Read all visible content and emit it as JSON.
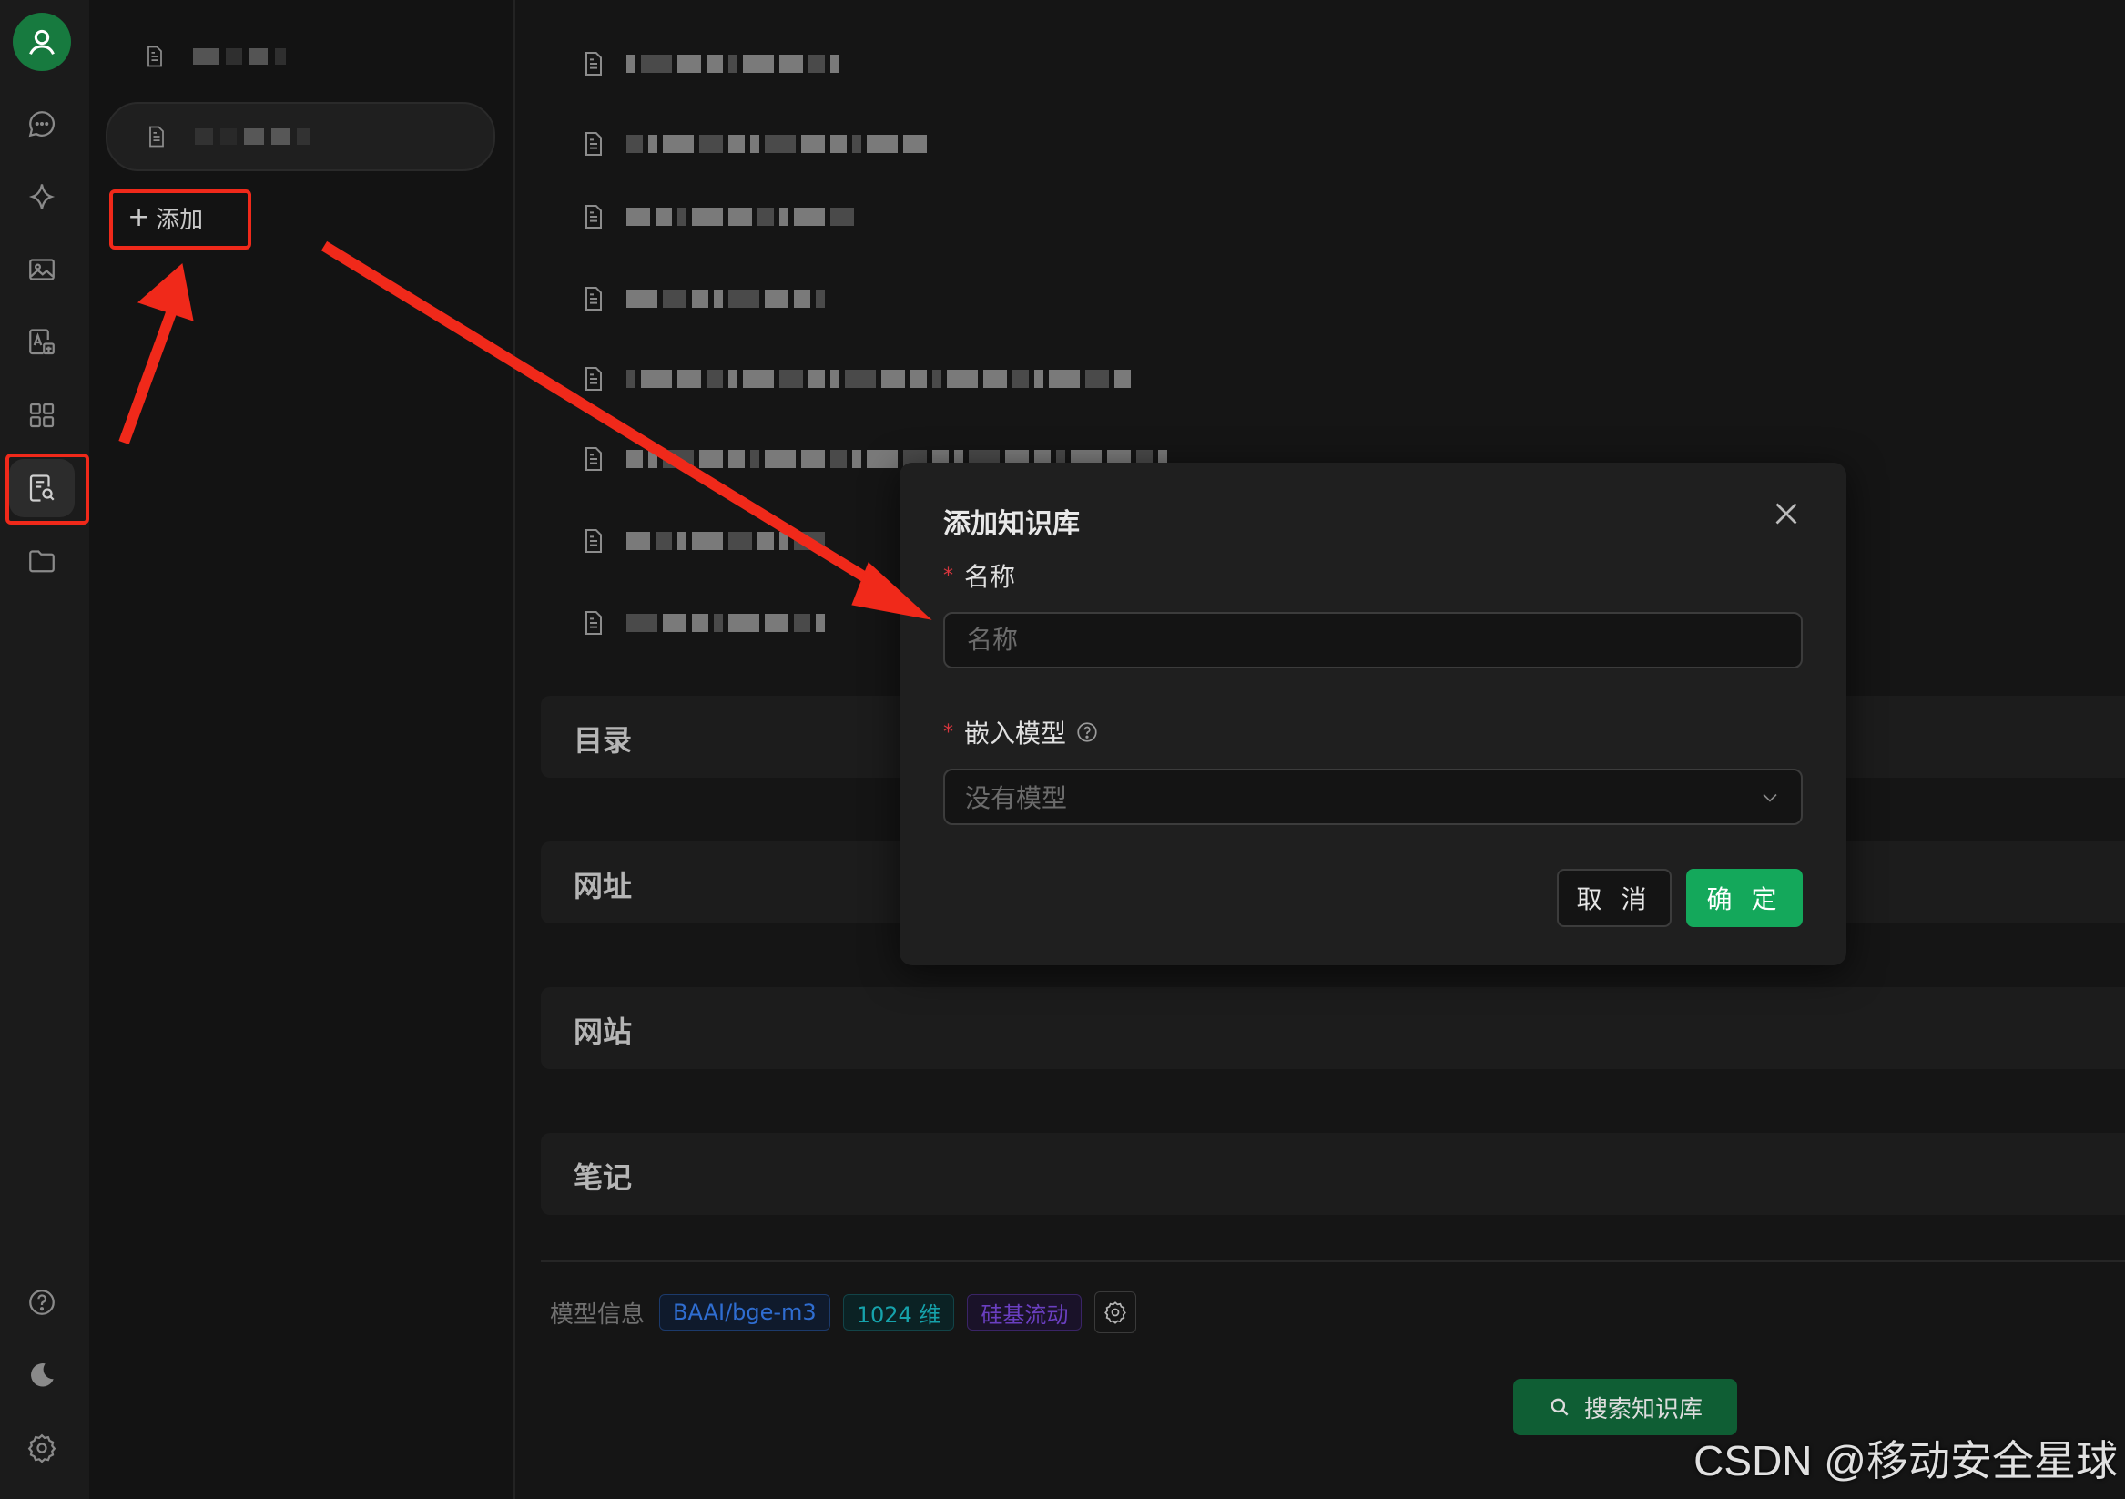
{
  "sidebar": {
    "icons": [
      "user-icon",
      "chat-icon",
      "sparkle-icon",
      "image-icon",
      "translate-icon",
      "apps-icon",
      "knowledge-base-icon",
      "folder-icon",
      "help-icon",
      "moon-icon",
      "settings-icon"
    ]
  },
  "kb_list": {
    "add_label": "添加"
  },
  "main": {
    "sections": [
      "目录",
      "网址",
      "网站",
      "笔记"
    ],
    "model_info": {
      "label": "模型信息",
      "tags": [
        "BAAI/bge-m3",
        "1024 维",
        "硅基流动"
      ]
    },
    "search_label": "搜索知识库"
  },
  "dialog": {
    "title": "添加知识库",
    "name_label": "名称",
    "name_placeholder": "名称",
    "model_label": "嵌入模型",
    "model_value": "没有模型",
    "required_mark": "*",
    "cancel_label": "取 消",
    "ok_label": "确 定"
  },
  "watermark": "CSDN @移动安全星球",
  "colors": {
    "accent": "#14a85b",
    "annotation": "#f0291a",
    "background": "#151515"
  }
}
